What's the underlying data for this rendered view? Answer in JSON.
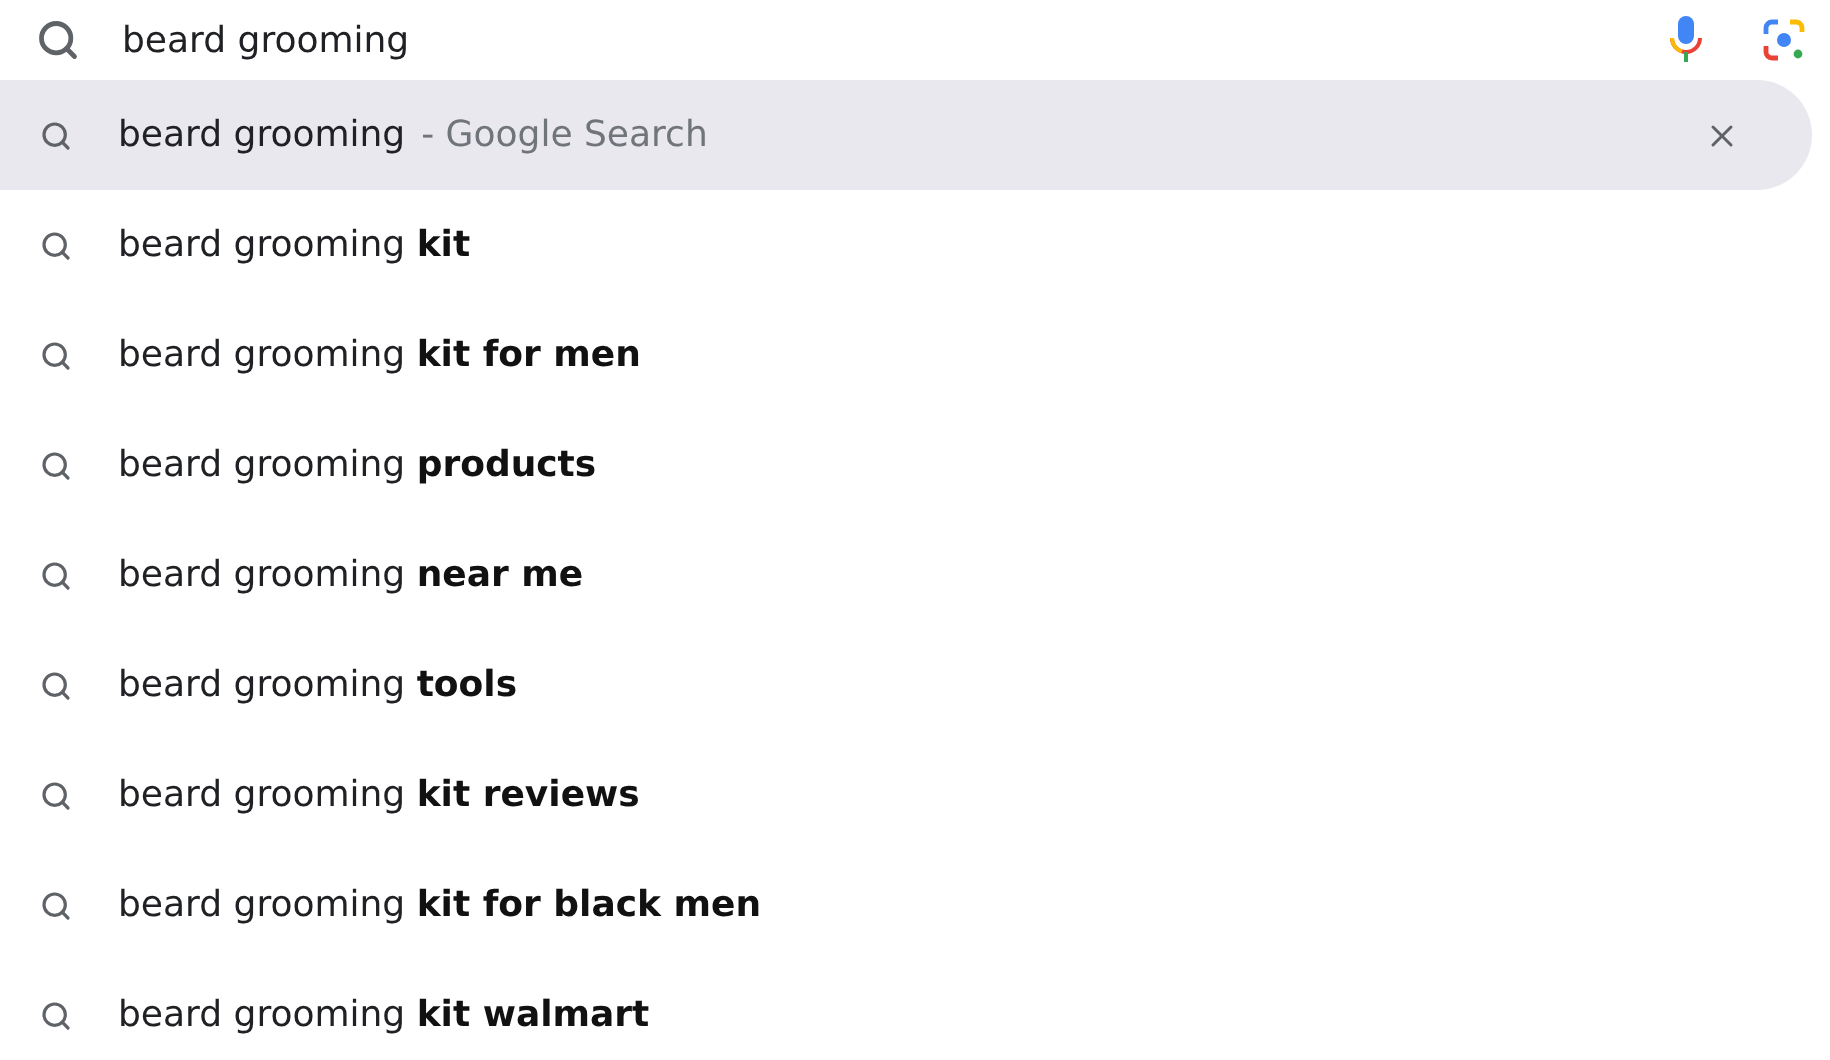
{
  "search": {
    "value": "beard grooming"
  },
  "suggestions": [
    {
      "text": "beard grooming",
      "suffix": "- Google Search",
      "selected": true
    },
    {
      "text": "beard grooming **kit**",
      "selected": false
    },
    {
      "text": "beard grooming **kit for men**",
      "selected": false
    },
    {
      "text": "beard grooming **products**",
      "selected": false
    },
    {
      "text": "beard grooming **near me**",
      "selected": false
    },
    {
      "text": "beard grooming **tools**",
      "selected": false
    },
    {
      "text": "beard grooming **kit reviews**",
      "selected": false
    },
    {
      "text": "beard grooming **kit for black men**",
      "selected": false
    },
    {
      "text": "beard grooming **kit walmart**",
      "selected": false
    }
  ]
}
